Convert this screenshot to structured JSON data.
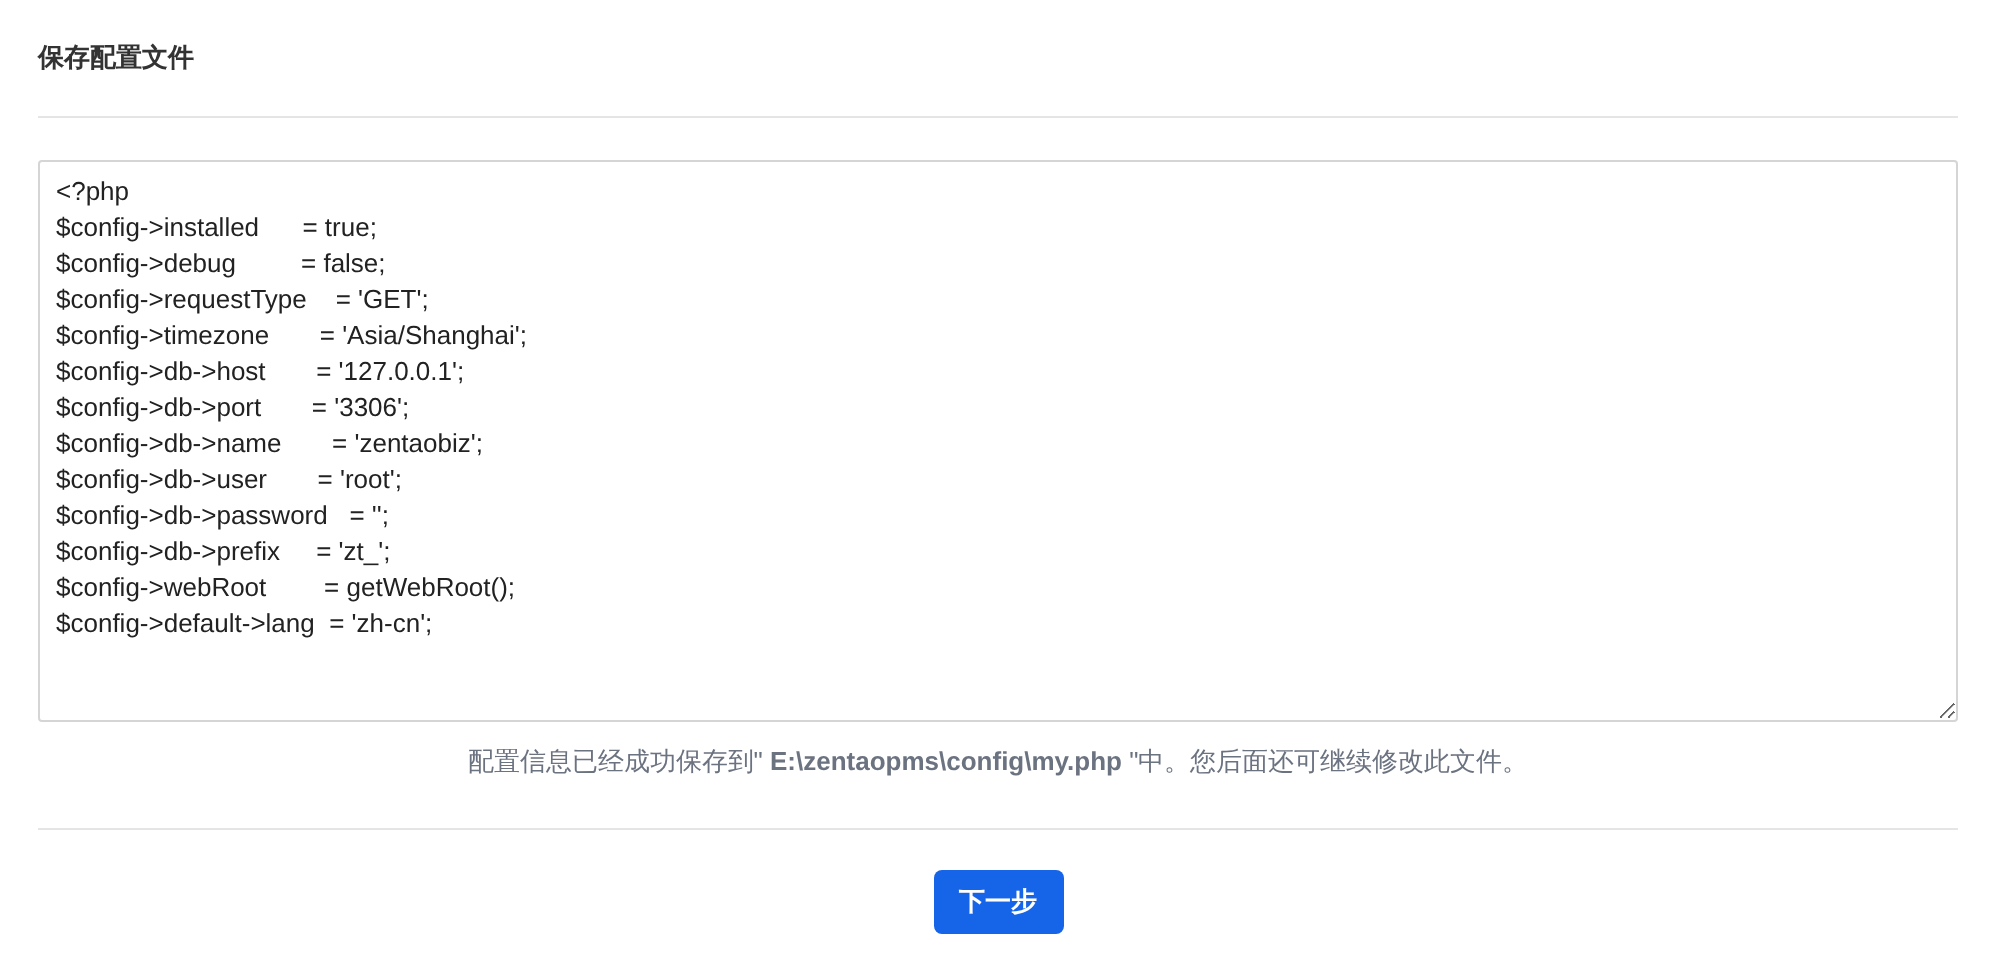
{
  "title": "保存配置文件",
  "config_file": {
    "lines": [
      "<?php",
      "$config->installed      = true;",
      "$config->debug         = false;",
      "$config->requestType    = 'GET';",
      "$config->timezone       = 'Asia/Shanghai';",
      "$config->db->host       = '127.0.0.1';",
      "$config->db->port       = '3306';",
      "$config->db->name       = 'zentaobiz';",
      "$config->db->user       = 'root';",
      "$config->db->password   = '';",
      "$config->db->prefix     = 'zt_';",
      "$config->webRoot        = getWebRoot();",
      "$config->default->lang  = 'zh-cn';"
    ]
  },
  "message": "配置信息已经成功保存到\" **E:\\zentaopms\\config\\my.php** \"中。您后面还可继续修改此文件。",
  "buttons": [
    "下一步"
  ]
}
